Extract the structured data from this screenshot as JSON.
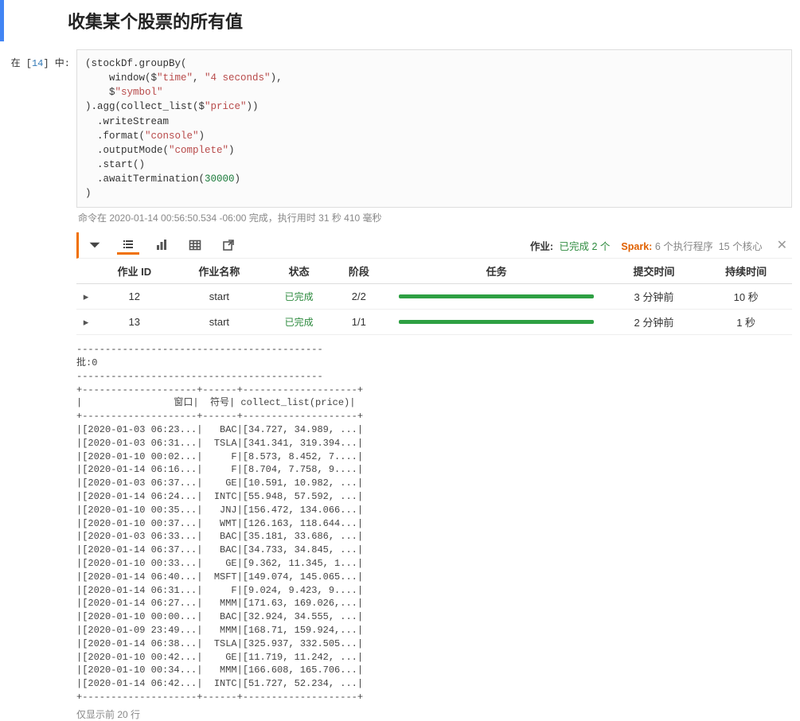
{
  "heading": "收集某个股票的所有值",
  "prompt": {
    "prefix": "在 [",
    "num": "14",
    "suffix": "] 中:"
  },
  "code": {
    "l1a": "(stockDf.groupBy(",
    "l2a": "    window($",
    "l2s1": "\"time\"",
    "l2b": ", ",
    "l2s2": "\"4 seconds\"",
    "l2c": "),",
    "l3a": "    $",
    "l3s1": "\"symbol\"",
    "l4a": ").agg(collect_list($",
    "l4s1": "\"price\"",
    "l4b": "))",
    "l5a": "  .writeStream",
    "l6a": "  .format(",
    "l6s1": "\"console\"",
    "l6b": ")",
    "l7a": "  .outputMode(",
    "l7s1": "\"complete\"",
    "l7b": ")",
    "l8a": "  .start()",
    "l9a": "  .awaitTermination(",
    "l9n": "30000",
    "l9b": ")",
    "l10a": ")"
  },
  "status_line": "命令在 2020-01-14 00:56:50.534 -06:00 完成，执行用时 31 秒 410 毫秒",
  "toolbar": {
    "jobs_lbl": "作业:",
    "jobs_val": "已完成 2 个",
    "spark_lbl": "Spark:",
    "executors": "6 个执行程序",
    "cores": "15 个核心"
  },
  "jobs": {
    "headers": [
      "作业 ID",
      "作业名称",
      "状态",
      "阶段",
      "任务",
      "提交时间",
      "持续时间"
    ],
    "rows": [
      {
        "id": "12",
        "name": "start",
        "status": "已完成",
        "stages": "2/2",
        "submitted": "3 分钟前",
        "duration": "10 秒"
      },
      {
        "id": "13",
        "name": "start",
        "status": "已完成",
        "stages": "1/1",
        "submitted": "2 分钟前",
        "duration": "1 秒"
      }
    ]
  },
  "output": "-------------------------------------------\n批:0\n-------------------------------------------\n+--------------------+------+--------------------+\n|                窗口|  符号| collect_list(price)|\n+--------------------+------+--------------------+\n|[2020-01-03 06:23...|   BAC|[34.727, 34.989, ...|\n|[2020-01-03 06:31...|  TSLA|[341.341, 319.394...|\n|[2020-01-10 00:02...|     F|[8.573, 8.452, 7....|\n|[2020-01-14 06:16...|     F|[8.704, 7.758, 9....|\n|[2020-01-03 06:37...|    GE|[10.591, 10.982, ...|\n|[2020-01-14 06:24...|  INTC|[55.948, 57.592, ...|\n|[2020-01-10 00:35...|   JNJ|[156.472, 134.066...|\n|[2020-01-10 00:37...|   WMT|[126.163, 118.644...|\n|[2020-01-03 06:33...|   BAC|[35.181, 33.686, ...|\n|[2020-01-14 06:37...|   BAC|[34.733, 34.845, ...|\n|[2020-01-10 00:33...|    GE|[9.362, 11.345, 1...|\n|[2020-01-14 06:40...|  MSFT|[149.074, 145.065...|\n|[2020-01-14 06:31...|     F|[9.024, 9.423, 9....|\n|[2020-01-14 06:27...|   MMM|[171.63, 169.026,...|\n|[2020-01-10 00:00...|   BAC|[32.924, 34.555, ...|\n|[2020-01-09 23:49...|   MMM|[168.71, 159.924,...|\n|[2020-01-14 06:38...|  TSLA|[325.937, 332.505...|\n|[2020-01-10 00:42...|    GE|[11.719, 11.242, ...|\n|[2020-01-10 00:34...|   MMM|[166.608, 165.706...|\n|[2020-01-14 06:42...|  INTC|[51.727, 52.234, ...|\n+--------------------+------+--------------------+",
  "footer": "仅显示前 20 行"
}
